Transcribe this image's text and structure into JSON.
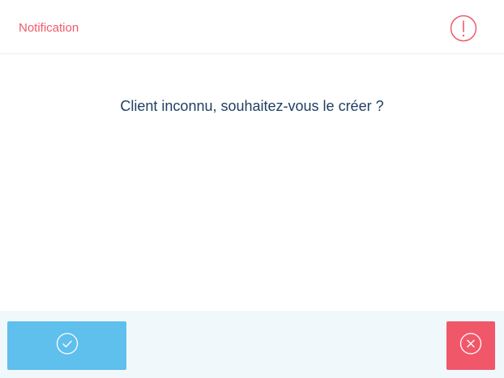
{
  "header": {
    "title": "Notification",
    "icon": "alert-circle-icon",
    "accent_color": "#ef5a6a"
  },
  "body": {
    "message": "Client inconnu, souhaitez-vous le créer ?",
    "text_color": "#1f3f63"
  },
  "footer": {
    "confirm_button": {
      "icon": "check-circle-icon",
      "color": "#5fbfed"
    },
    "cancel_button": {
      "icon": "close-circle-icon",
      "color": "#f0586a"
    },
    "background": "#f1f8fb"
  }
}
